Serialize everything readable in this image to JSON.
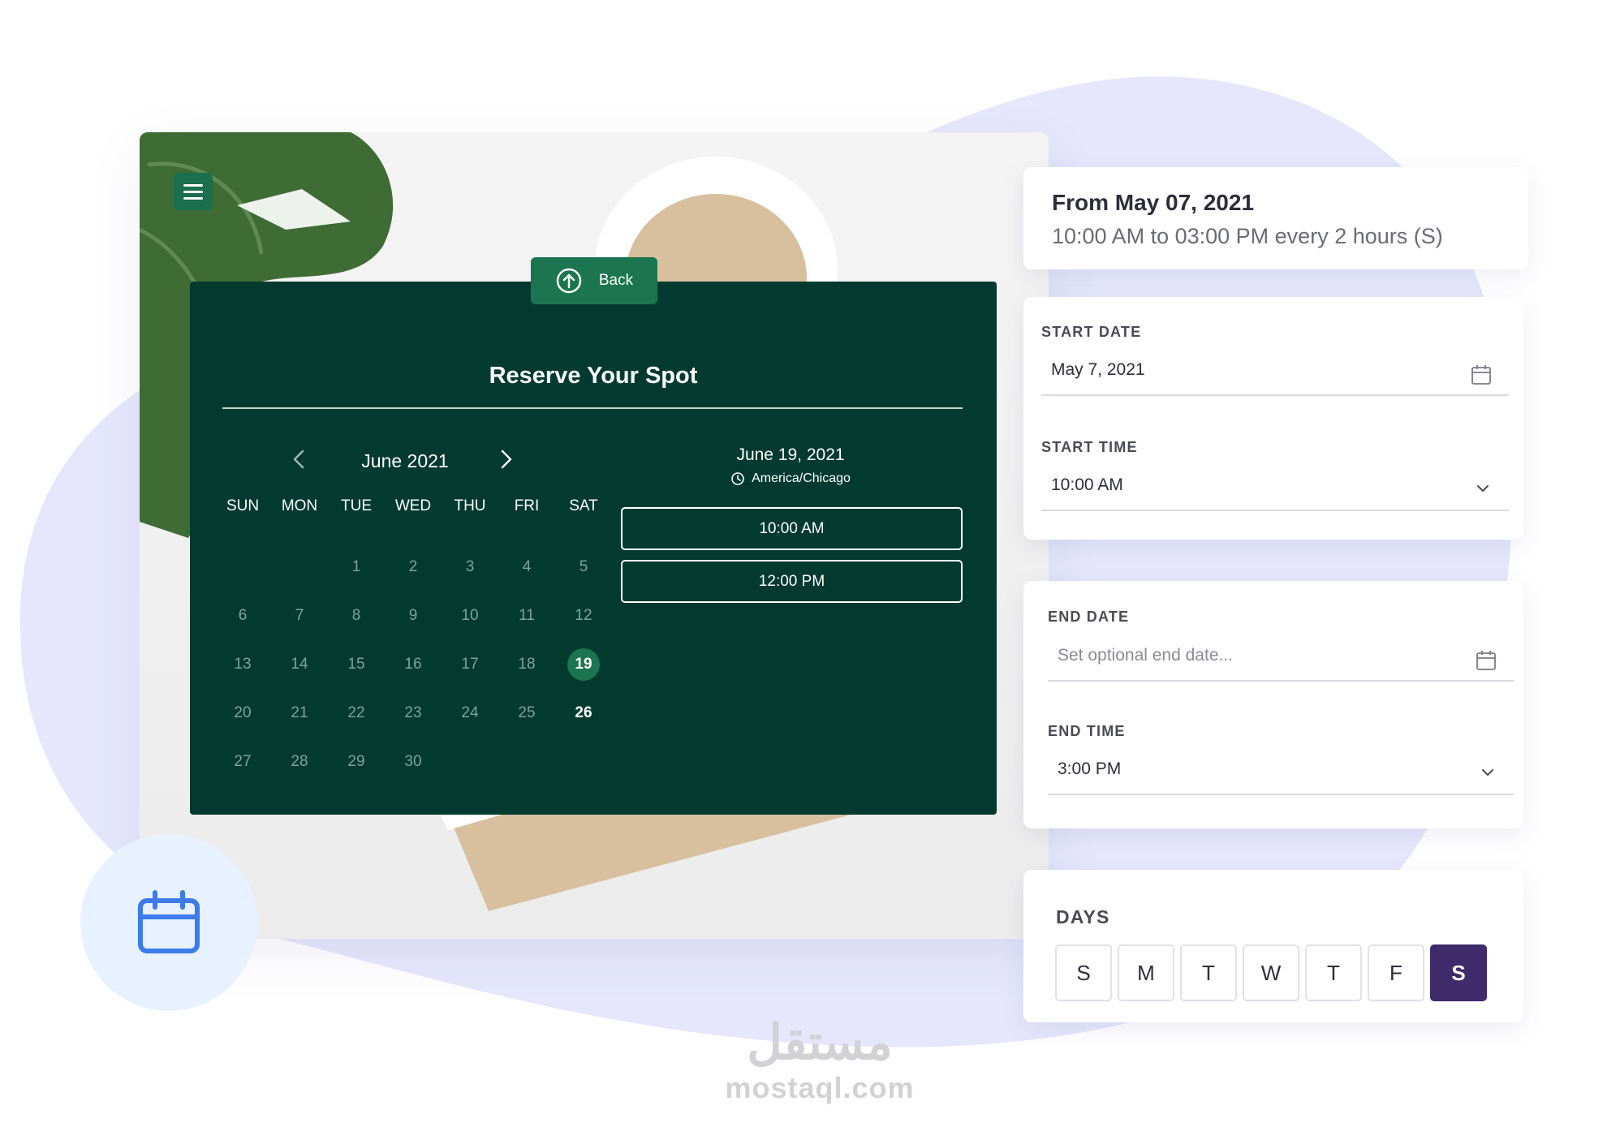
{
  "calendar": {
    "back_label": "Back",
    "title": "Reserve Your Spot",
    "month_label": "June 2021",
    "weekdays": [
      "SUN",
      "MON",
      "TUE",
      "WED",
      "THU",
      "FRI",
      "SAT"
    ],
    "weeks": [
      [
        "",
        "",
        "1",
        "2",
        "3",
        "4",
        "5"
      ],
      [
        "6",
        "7",
        "8",
        "9",
        "10",
        "11",
        "12"
      ],
      [
        "13",
        "14",
        "15",
        "16",
        "17",
        "18",
        "19"
      ],
      [
        "20",
        "21",
        "22",
        "23",
        "24",
        "25",
        "26"
      ],
      [
        "27",
        "28",
        "29",
        "30",
        "",
        "",
        ""
      ]
    ],
    "selected_day": "19",
    "available_days": [
      "26"
    ],
    "selected_date": "June 19, 2021",
    "timezone": "America/Chicago",
    "slots": [
      "10:00 AM",
      "12:00 PM"
    ]
  },
  "summary": {
    "heading": "From May 07, 2021",
    "detail": "10:00 AM to 03:00 PM every 2 hours (S)"
  },
  "start": {
    "date_label": "START DATE",
    "date_value": "May 7, 2021",
    "time_label": "START TIME",
    "time_value": "10:00 AM"
  },
  "end": {
    "date_label": "END DATE",
    "date_placeholder": "Set optional end date...",
    "time_label": "END TIME",
    "time_value": "3:00 PM"
  },
  "days": {
    "label": "DAYS",
    "items": [
      "S",
      "M",
      "T",
      "W",
      "T",
      "F",
      "S"
    ],
    "active_index": 6
  },
  "watermark": {
    "arabic": "مستقل",
    "latin": "mostaql.com"
  },
  "colors": {
    "panel": "#023a30",
    "accent_green": "#1a7550",
    "active_day": "#3f2a6b",
    "blob": "#e3e4fb"
  }
}
